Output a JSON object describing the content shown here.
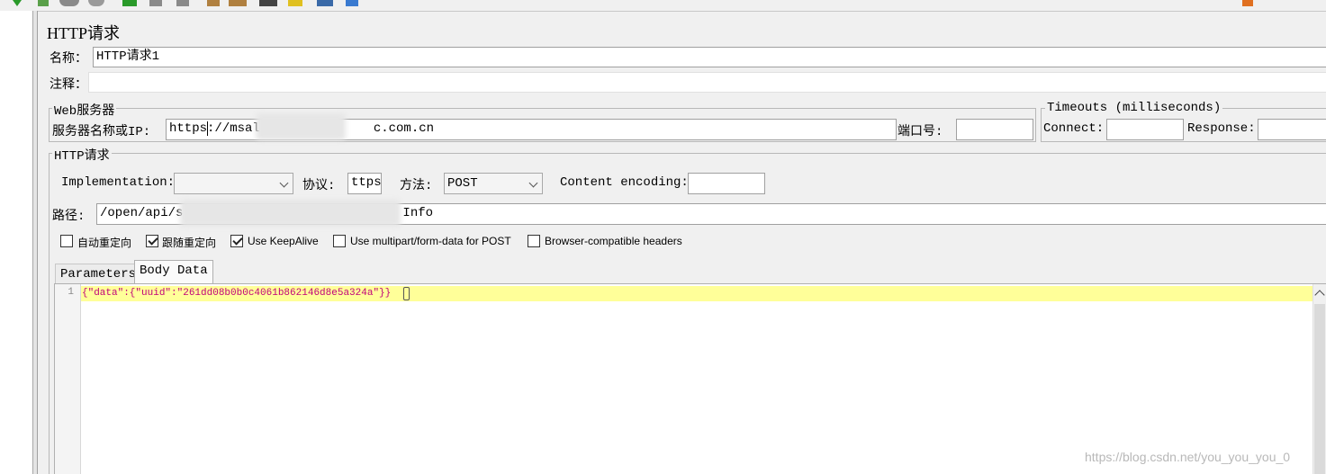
{
  "panel_title": "HTTP请求",
  "name_label": "名称：",
  "name_value": "HTTP请求1",
  "comment_label": "注释：",
  "web_server": {
    "legend": "Web服务器",
    "server_label": "服务器名称或IP:",
    "server_value_start": "https",
    "server_value_mid": "://msal",
    "server_value_end": "c.com.cn",
    "port_label": "端口号:",
    "port_value": ""
  },
  "timeouts": {
    "legend": "Timeouts (milliseconds)",
    "connect_label": "Connect:",
    "connect_value": "",
    "response_label": "Response:",
    "response_value": ""
  },
  "http_request": {
    "legend": "HTTP请求",
    "implementation_label": "Implementation:",
    "implementation_value": "",
    "protocol_label": "协议:",
    "protocol_value": "ttps",
    "method_label": "方法:",
    "method_value": "POST",
    "encoding_label": "Content encoding:",
    "encoding_value": "",
    "path_label": "路径:",
    "path_value_start": "/open/api/s",
    "path_value_end": "Info"
  },
  "checkboxes": [
    {
      "label": "自动重定向",
      "checked": false
    },
    {
      "label": "跟随重定向",
      "checked": true
    },
    {
      "label": "Use KeepAlive",
      "checked": true
    },
    {
      "label": "Use multipart/form-data for POST",
      "checked": false
    },
    {
      "label": "Browser-compatible headers",
      "checked": false
    }
  ],
  "tabs": [
    {
      "label": "Parameters",
      "active": false
    },
    {
      "label": "Body Data",
      "active": true
    }
  ],
  "editor": {
    "line_number": "1",
    "code": "{\"data\":{\"uuid\":\"261dd08b0b0c4061b862146d8e5a324a\"}}"
  },
  "watermark": "https://blog.csdn.net/you_you_you_0",
  "colors": {
    "highlight_line": "#ffff99",
    "code_text": "#c0007a",
    "background": "#f0f0f0"
  }
}
